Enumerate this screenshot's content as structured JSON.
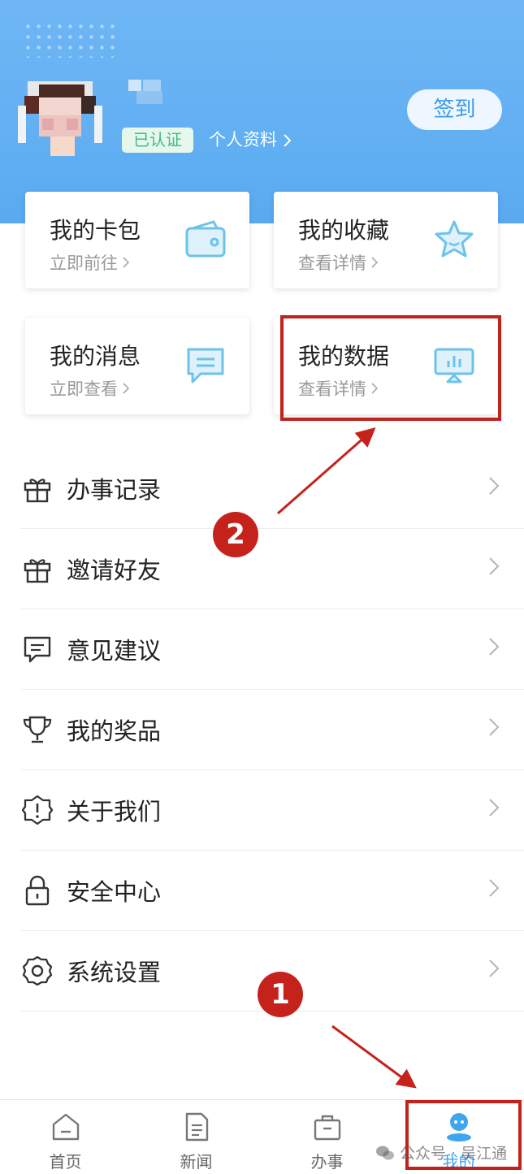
{
  "header": {
    "verified_badge": "已认证",
    "profile_link": "个人资料",
    "checkin_button": "签到"
  },
  "cards": [
    {
      "title": "我的卡包",
      "subtitle": "立即前往",
      "icon": "wallet-icon"
    },
    {
      "title": "我的收藏",
      "subtitle": "查看详情",
      "icon": "star-icon"
    },
    {
      "title": "我的消息",
      "subtitle": "立即查看",
      "icon": "message-icon"
    },
    {
      "title": "我的数据",
      "subtitle": "查看详情",
      "icon": "data-screen-icon"
    }
  ],
  "menu": [
    {
      "label": "办事记录",
      "icon": "gift-icon"
    },
    {
      "label": "邀请好友",
      "icon": "gift-icon"
    },
    {
      "label": "意见建议",
      "icon": "feedback-icon"
    },
    {
      "label": "我的奖品",
      "icon": "trophy-icon"
    },
    {
      "label": "关于我们",
      "icon": "info-shield-icon"
    },
    {
      "label": "安全中心",
      "icon": "lock-icon"
    },
    {
      "label": "系统设置",
      "icon": "gear-icon"
    }
  ],
  "annotations": {
    "step1": "1",
    "step2": "2",
    "highlight_color": "#c0231c"
  },
  "tabbar": [
    {
      "label": "首页",
      "icon": "home-icon"
    },
    {
      "label": "新闻",
      "icon": "news-icon"
    },
    {
      "label": "办事",
      "icon": "briefcase-icon"
    },
    {
      "label": "我的",
      "icon": "profile-icon",
      "active": true
    }
  ],
  "watermark": "公众号 · 吴江通",
  "colors": {
    "header_blue": "#5aaaf1",
    "accent": "#3fa6ee",
    "verified_green": "#3fbd7c"
  }
}
